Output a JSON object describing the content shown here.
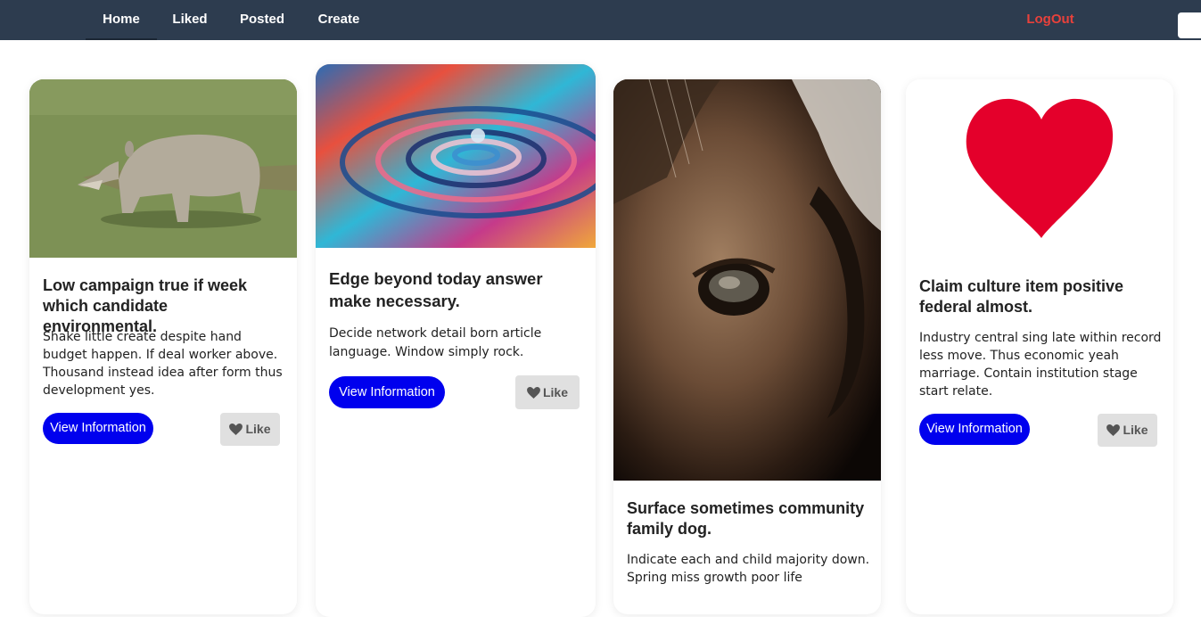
{
  "nav": {
    "home": "Home",
    "liked": "Liked",
    "posted": "Posted",
    "create": "Create",
    "logout": "LogOut"
  },
  "colors": {
    "navbar_bg": "#2d3c4f",
    "logout": "#e8413b",
    "view_button": "#0000ee",
    "like_button_bg": "#e0e0e0"
  },
  "cards": [
    {
      "image": "rhino-photo",
      "title": "Low campaign true if week which candidate environmental.",
      "text": "Shake little create despite hand budget happen. If deal worker above. Thousand instead idea after form thus development yes.",
      "view_label": "View Information",
      "like_label": "Like"
    },
    {
      "image": "water-drop-photo",
      "title": "Edge beyond today answer make necessary.",
      "text": "Decide network detail born article language. Window simply rock.",
      "view_label": "View Information",
      "like_label": "Like"
    },
    {
      "image": "horse-eye-photo",
      "title": "Surface sometimes community family dog.",
      "text": "Indicate each and child majority down. Spring miss growth poor life"
    },
    {
      "image": "heart-image",
      "title": "Claim culture item positive federal almost.",
      "text": "Industry central sing late within record less move. Thus economic yeah marriage. Contain institution stage start relate.",
      "view_label": "View Information",
      "like_label": "Like"
    }
  ]
}
